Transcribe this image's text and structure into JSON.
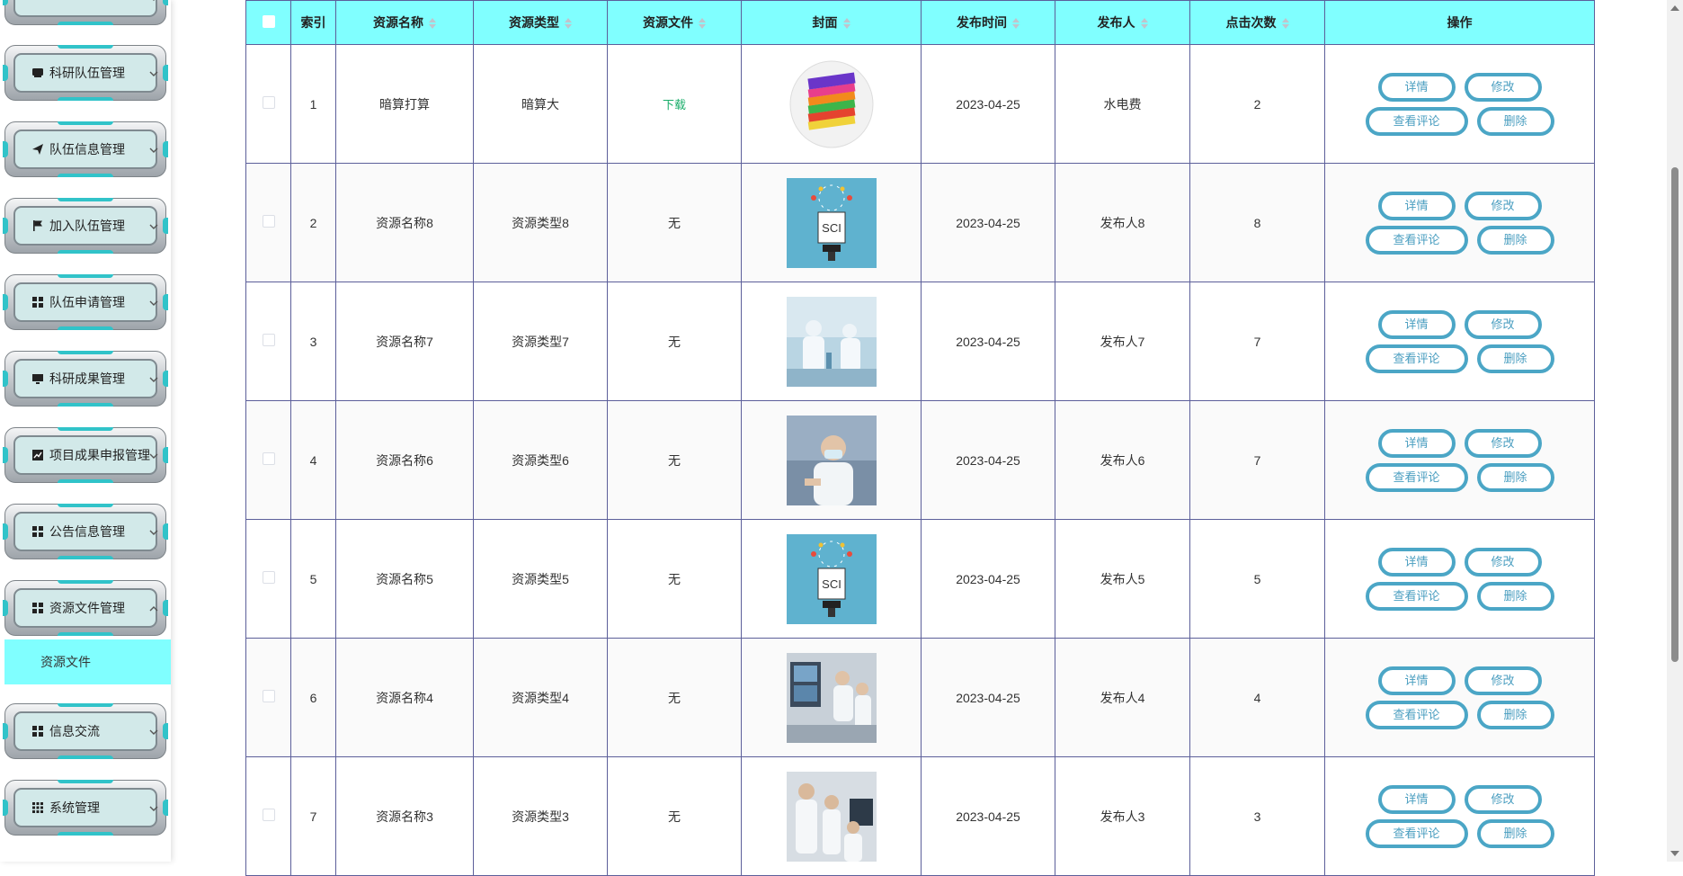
{
  "sidebar": {
    "items": [
      {
        "label": "",
        "icon": "top-partial-icon",
        "expanded": false
      },
      {
        "label": "科研队伍管理",
        "icon": "inbox-icon",
        "expanded": false
      },
      {
        "label": "队伍信息管理",
        "icon": "send-icon",
        "expanded": false
      },
      {
        "label": "加入队伍管理",
        "icon": "flag-icon",
        "expanded": false
      },
      {
        "label": "队伍申请管理",
        "icon": "grid-icon",
        "expanded": false
      },
      {
        "label": "科研成果管理",
        "icon": "monitor-icon",
        "expanded": false
      },
      {
        "label": "项目成果申报管理",
        "icon": "trend-chart-icon",
        "expanded": false
      },
      {
        "label": "公告信息管理",
        "icon": "grid-icon",
        "expanded": false
      },
      {
        "label": "资源文件管理",
        "icon": "grid-icon",
        "expanded": true
      },
      {
        "label": "信息交流",
        "icon": "grid-icon",
        "expanded": false
      },
      {
        "label": "系统管理",
        "icon": "apps-icon",
        "expanded": false
      }
    ],
    "active_submenu": "资源文件"
  },
  "table": {
    "columns": [
      "索引",
      "资源名称",
      "资源类型",
      "资源文件",
      "封面",
      "发布时间",
      "发布人",
      "点击次数",
      "操作"
    ],
    "sortable": [
      false,
      true,
      true,
      true,
      true,
      true,
      true,
      true,
      false
    ],
    "rows": [
      {
        "index": "1",
        "name": "暗算打算",
        "type": "暗算大",
        "file": "下载",
        "file_link": true,
        "cover": "books-icon",
        "date": "2023-04-25",
        "publisher": "水电费",
        "clicks": "2"
      },
      {
        "index": "2",
        "name": "资源名称8",
        "type": "资源类型8",
        "file": "无",
        "file_link": false,
        "cover": "sci-research-image",
        "date": "2023-04-25",
        "publisher": "发布人8",
        "clicks": "8"
      },
      {
        "index": "3",
        "name": "资源名称7",
        "type": "资源类型7",
        "file": "无",
        "file_link": false,
        "cover": "lab-scientists-image",
        "date": "2023-04-25",
        "publisher": "发布人7",
        "clicks": "7"
      },
      {
        "index": "4",
        "name": "资源名称6",
        "type": "资源类型6",
        "file": "无",
        "file_link": false,
        "cover": "doctor-mask-image",
        "date": "2023-04-25",
        "publisher": "发布人6",
        "clicks": "7"
      },
      {
        "index": "5",
        "name": "资源名称5",
        "type": "资源类型5",
        "file": "无",
        "file_link": false,
        "cover": "sci-research-image",
        "date": "2023-04-25",
        "publisher": "发布人5",
        "clicks": "5"
      },
      {
        "index": "6",
        "name": "资源名称4",
        "type": "资源类型4",
        "file": "无",
        "file_link": false,
        "cover": "lab-screens-image",
        "date": "2023-04-25",
        "publisher": "发布人4",
        "clicks": "4"
      },
      {
        "index": "7",
        "name": "资源名称3",
        "type": "资源类型3",
        "file": "无",
        "file_link": false,
        "cover": "lab-team-image",
        "date": "2023-04-25",
        "publisher": "发布人3",
        "clicks": "3"
      }
    ],
    "actions": {
      "detail": "详情",
      "edit": "修改",
      "comments": "查看评论",
      "delete": "删除"
    }
  },
  "colors": {
    "header_bg": "#80ffff",
    "border": "#5c5f9a",
    "action_border": "#4ba6c6",
    "link_green": "#1aad6a",
    "submenu_bg": "#80ffff"
  }
}
